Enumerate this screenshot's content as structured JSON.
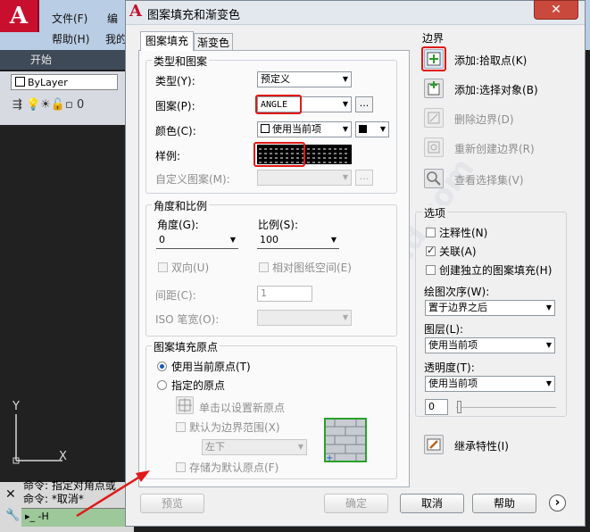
{
  "background": {
    "menu_file": "文件(F)",
    "menu_edit": "编",
    "menu_help": "帮助(H)",
    "menu_other": "我的",
    "tab_start": "开始",
    "bylayer": "ByLayer",
    "layer_num": "0",
    "ucs_y": "Y",
    "ucs_x": "X",
    "cmd_line1": "命令: 指定对角点或",
    "cmd_line2": "命令: *取消*",
    "cmd_input": "-H"
  },
  "dialog": {
    "title": "图案填充和渐变色",
    "close_label": "✕",
    "tabs": [
      "图案填充",
      "渐变色"
    ],
    "type_pattern_group": {
      "title": "类型和图案",
      "type_label": "类型(Y):",
      "type_value": "预定义",
      "pattern_label": "图案(P):",
      "pattern_value": "ANGLE",
      "color_label": "颜色(C):",
      "color_value": "使用当前项",
      "swatch_label": "样例:",
      "custom_label": "自定义图案(M):",
      "dots": "..."
    },
    "angle_scale_group": {
      "title": "角度和比例",
      "angle_label": "角度(G):",
      "angle_value": "0",
      "scale_label": "比例(S):",
      "scale_value": "100",
      "double_label": "双向(U)",
      "relative_label": "相对图纸空间(E)",
      "spacing_label": "间距(C):",
      "spacing_value": "1",
      "iso_label": "ISO 笔宽(O):"
    },
    "origin_group": {
      "title": "图案填充原点",
      "use_current": "使用当前原点(T)",
      "specified": "指定的原点",
      "click_set": "单击以设置新原点",
      "default_extent": "默认为边界范围(X)",
      "extent_value": "左下",
      "store_default": "存储为默认原点(F)"
    },
    "boundary": {
      "title": "边界",
      "add_pick": "添加:拾取点(K)",
      "add_select": "添加:选择对象(B)",
      "remove": "删除边界(D)",
      "recreate": "重新创建边界(R)",
      "view_selection": "查看选择集(V)"
    },
    "options": {
      "title": "选项",
      "annotative": "注释性(N)",
      "associative": "关联(A)",
      "independent": "创建独立的图案填充(H)",
      "draw_order_label": "绘图次序(W):",
      "draw_order_value": "置于边界之后",
      "layer_label": "图层(L):",
      "layer_value": "使用当前项",
      "transparency_label": "透明度(T):",
      "transparency_value": "使用当前项",
      "transparency_num": "0"
    },
    "inherit": "继承特性(I)",
    "buttons": {
      "preview": "预览",
      "ok": "确定",
      "cancel": "取消",
      "help": "帮助",
      "more": "›"
    }
  },
  "colors": {
    "highlight": "#e01919",
    "dialog_bg": "#f0f0f0",
    "autocad_red": "#c8102e"
  }
}
